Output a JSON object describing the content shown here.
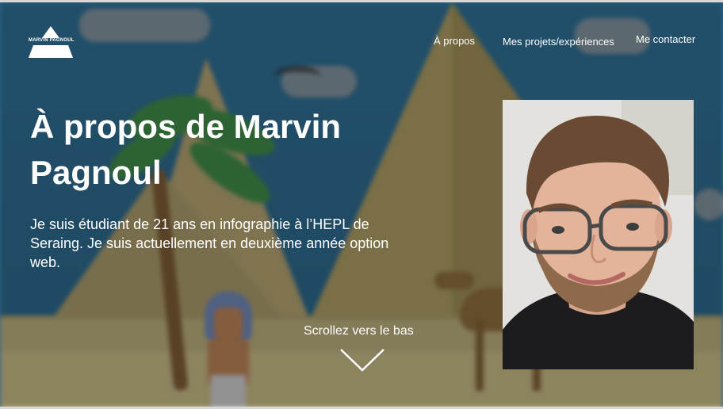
{
  "logo": {
    "text": "MARVIN PAGNOUL",
    "icon": "pyramid-logo-icon"
  },
  "nav": {
    "about": "À propos",
    "projects": "Mes projets/expériences",
    "contact": "Me contacter"
  },
  "hero": {
    "title": "À propos de Marvin Pagnoul",
    "intro": "Je suis étudiant de 21 ans en infographie à l’HEPL de Seraing. Je suis actuellement en deuxième année option web."
  },
  "scroll": {
    "label": "Scrollez vers le bas",
    "icon": "chevron-down-icon"
  },
  "colors": {
    "text": "#ffffff",
    "sky": "#2d6a8d",
    "sand": "#b7ab7a"
  }
}
